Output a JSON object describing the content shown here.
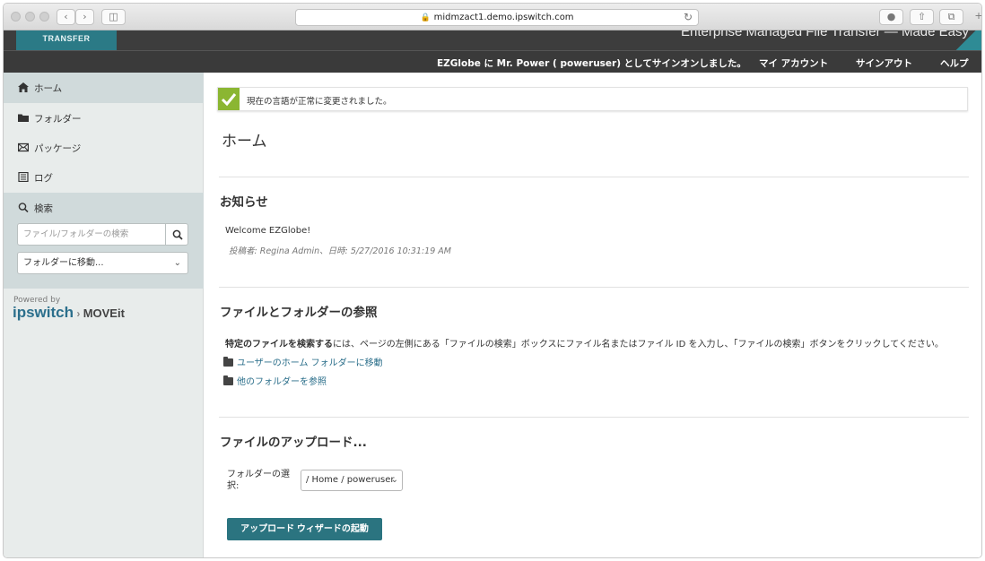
{
  "browser": {
    "url": "midmzact1.demo.ipswitch.com"
  },
  "header": {
    "logo_text": "TRANSFER",
    "tagline": "Enterprise Managed File Transfer — Made Easy",
    "signed_in_text": "EZGlobe に Mr. Power ( poweruser) としてサインオンしました。",
    "nav": {
      "my_account": "マイ アカウント",
      "sign_out": "サインアウト",
      "help": "ヘルプ"
    }
  },
  "sidebar": {
    "items": [
      {
        "label": "ホーム",
        "icon": "home-icon"
      },
      {
        "label": "フォルダー",
        "icon": "folder-icon"
      },
      {
        "label": "パッケージ",
        "icon": "envelope-icon"
      },
      {
        "label": "ログ",
        "icon": "log-icon"
      }
    ],
    "search": {
      "label": "検索",
      "placeholder": "ファイル/フォルダーの検索",
      "goto_folder": "フォルダーに移動..."
    },
    "powered_by": "Powered by",
    "brand": "ipswitch",
    "brand_product": "MOVEit"
  },
  "main": {
    "alert": "現在の言語が正常に変更されました。",
    "title": "ホーム",
    "announcements": {
      "heading": "お知らせ",
      "message": "Welcome EZGlobe!",
      "posted": "投稿者: Regina Admin、日時: 5/27/2016 10:31:19 AM"
    },
    "browse": {
      "heading": "ファイルとフォルダーの参照",
      "instructions_bold": "特定のファイルを検索する",
      "instructions_rest": "には、ページの左側にある「ファイルの検索」ボックスにファイル名またはファイル ID を入力し、「ファイルの検索」ボタンをクリックしてください。",
      "link_home": "ユーザーのホーム フォルダーに移動",
      "link_other": "他のフォルダーを参照"
    },
    "upload": {
      "heading": "ファイルのアップロード...",
      "folder_label": "フォルダーの選択:",
      "folder_value": "/ Home / poweruser",
      "button": "アップロード ウィザードの起動"
    }
  },
  "colors": {
    "accent": "#2b7480",
    "success": "#8bb632",
    "link": "#2a6e8a"
  }
}
